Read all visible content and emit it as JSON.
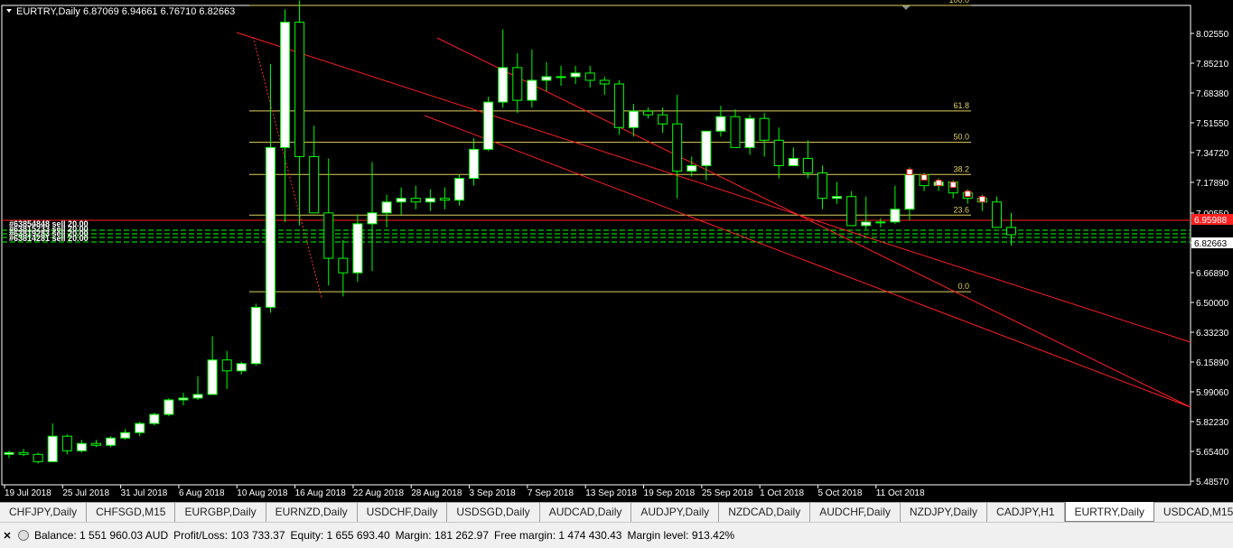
{
  "chart_data": {
    "type": "candlestick",
    "title": "EURTRY,Daily",
    "ohlc_header": "6.87069 6.94661 6.76710 6.82663",
    "ylim": [
      5.4525,
      8.0925
    ],
    "price_ticks": [
      "8.02550",
      "7.85210",
      "7.68380",
      "7.51550",
      "7.34720",
      "7.17890",
      "7.00550",
      "6.83720",
      "6.66890",
      "6.50000",
      "6.33230",
      "6.15890",
      "5.99060",
      "5.82230",
      "5.65400",
      "5.48570"
    ],
    "date_labels": [
      "19 Jul 2018",
      "25 Jul 2018",
      "31 Jul 2018",
      "6 Aug 2018",
      "10 Aug 2018",
      "16 Aug 2018",
      "22 Aug 2018",
      "28 Aug 2018",
      "3 Sep 2018",
      "7 Sep 2018",
      "13 Sep 2018",
      "19 Sep 2018",
      "25 Sep 2018",
      "1 Oct 2018",
      "5 Oct 2018",
      "11 Oct 2018"
    ],
    "date_label_slots": [
      0,
      4,
      8,
      12,
      16,
      20,
      24,
      28,
      32,
      36,
      40,
      44,
      48,
      52,
      56,
      60
    ],
    "current_price": "6.82663",
    "order_price": "6.95988",
    "candles": [
      [
        5.62,
        5.64,
        5.6,
        5.63
      ],
      [
        5.63,
        5.65,
        5.61,
        5.62
      ],
      [
        5.62,
        5.63,
        5.57,
        5.58
      ],
      [
        5.58,
        5.79,
        5.58,
        5.72
      ],
      [
        5.72,
        5.73,
        5.62,
        5.64
      ],
      [
        5.64,
        5.7,
        5.63,
        5.68
      ],
      [
        5.68,
        5.7,
        5.66,
        5.67
      ],
      [
        5.67,
        5.72,
        5.66,
        5.71
      ],
      [
        5.71,
        5.76,
        5.7,
        5.74
      ],
      [
        5.74,
        5.8,
        5.72,
        5.79
      ],
      [
        5.79,
        5.85,
        5.78,
        5.84
      ],
      [
        5.84,
        5.93,
        5.83,
        5.92
      ],
      [
        5.92,
        5.96,
        5.89,
        5.93
      ],
      [
        5.93,
        6.05,
        5.92,
        5.95
      ],
      [
        5.95,
        6.27,
        5.95,
        6.14
      ],
      [
        6.14,
        6.19,
        5.98,
        6.08
      ],
      [
        6.08,
        6.13,
        6.06,
        6.12
      ],
      [
        6.12,
        6.45,
        6.11,
        6.43
      ],
      [
        6.43,
        7.77,
        6.4,
        7.31
      ],
      [
        7.31,
        8.07,
        6.9,
        8.0
      ],
      [
        8.0,
        8.12,
        6.88,
        7.26
      ],
      [
        7.26,
        7.43,
        7.14,
        6.95
      ],
      [
        6.95,
        7.25,
        6.55,
        6.7
      ],
      [
        6.7,
        6.8,
        6.49,
        6.62
      ],
      [
        6.62,
        6.94,
        6.57,
        6.89
      ],
      [
        6.89,
        7.23,
        6.63,
        6.95
      ],
      [
        6.95,
        7.05,
        6.87,
        7.01
      ],
      [
        7.01,
        7.09,
        6.94,
        7.03
      ],
      [
        7.03,
        7.1,
        6.97,
        7.01
      ],
      [
        7.01,
        7.08,
        6.96,
        7.03
      ],
      [
        7.03,
        7.09,
        6.97,
        7.02
      ],
      [
        7.02,
        7.16,
        6.99,
        7.14
      ],
      [
        7.14,
        7.36,
        7.1,
        7.3
      ],
      [
        7.3,
        7.59,
        7.29,
        7.56
      ],
      [
        7.56,
        7.96,
        7.53,
        7.75
      ],
      [
        7.75,
        7.83,
        7.5,
        7.57
      ],
      [
        7.57,
        7.85,
        7.53,
        7.68
      ],
      [
        7.68,
        7.78,
        7.62,
        7.7
      ],
      [
        7.7,
        7.76,
        7.65,
        7.7
      ],
      [
        7.7,
        7.76,
        7.66,
        7.72
      ],
      [
        7.72,
        7.76,
        7.64,
        7.68
      ],
      [
        7.68,
        7.7,
        7.6,
        7.66
      ],
      [
        7.66,
        7.68,
        7.38,
        7.42
      ],
      [
        7.42,
        7.55,
        7.37,
        7.51
      ],
      [
        7.51,
        7.53,
        7.47,
        7.49
      ],
      [
        7.49,
        7.53,
        7.39,
        7.44
      ],
      [
        7.44,
        7.6,
        7.03,
        7.18
      ],
      [
        7.18,
        7.26,
        7.15,
        7.21
      ],
      [
        7.21,
        7.4,
        7.13,
        7.4
      ],
      [
        7.4,
        7.54,
        7.37,
        7.48
      ],
      [
        7.48,
        7.52,
        7.32,
        7.31
      ],
      [
        7.31,
        7.49,
        7.27,
        7.47
      ],
      [
        7.47,
        7.5,
        7.26,
        7.35
      ],
      [
        7.35,
        7.42,
        7.14,
        7.21
      ],
      [
        7.21,
        7.31,
        7.21,
        7.25
      ],
      [
        7.25,
        7.35,
        7.14,
        7.17
      ],
      [
        7.17,
        7.21,
        6.97,
        7.03
      ],
      [
        7.03,
        7.12,
        7.0,
        7.04
      ],
      [
        7.04,
        7.07,
        6.98,
        6.88
      ],
      [
        6.88,
        7.04,
        6.86,
        6.9
      ],
      [
        6.9,
        6.92,
        6.87,
        6.9
      ],
      [
        6.9,
        7.1,
        6.89,
        6.97
      ],
      [
        6.97,
        7.2,
        6.91,
        7.16
      ],
      [
        7.16,
        7.17,
        7.07,
        7.1
      ],
      [
        7.1,
        7.14,
        7.07,
        7.12
      ],
      [
        7.12,
        7.13,
        7.03,
        7.06
      ],
      [
        7.06,
        7.08,
        7.0,
        7.03
      ],
      [
        7.03,
        7.05,
        6.96,
        7.01
      ],
      [
        7.01,
        7.04,
        6.87,
        6.87
      ],
      [
        6.87,
        6.95,
        6.77,
        6.83
      ]
    ],
    "fibonacci": [
      {
        "label": "100.0",
        "price": 8.0925
      },
      {
        "label": "61.8",
        "price": 7.5117
      },
      {
        "label": "50.0",
        "price": 7.3389
      },
      {
        "label": "38.2",
        "price": 7.1614
      },
      {
        "label": "23.6",
        "price": 6.9377
      },
      {
        "label": "0.0",
        "price": 6.5158
      }
    ],
    "order_labels": [
      "#63854848 sell 20.00",
      "#63815233 sell 20.00",
      "#63819283 sell 20.00",
      "#63814281 sell 20.00"
    ]
  },
  "tabs": [
    "CHFJPY,Daily",
    "CHFSGD,M15",
    "EURGBP,Daily",
    "EURNZD,Daily",
    "USDCHF,Daily",
    "USDSGD,Daily",
    "AUDCAD,Daily",
    "AUDJPY,Daily",
    "NZDCAD,Daily",
    "AUDCHF,Daily",
    "NZDJPY,Daily",
    "CADJPY,H1",
    "EURTRY,Daily",
    "USDCAD,M15"
  ],
  "active_tab": "EURTRY,Daily",
  "tab_arrows": {
    "left": "◄",
    "right": "►"
  },
  "status": {
    "balance": "Balance: 1 551 960.03 AUD",
    "profit": "Profit/Loss: 103 733.37",
    "equity": "Equity: 1 655 693.40",
    "margin": "Margin: 181 262.97",
    "free_margin": "Free margin: 1 474 430.43",
    "margin_level": "Margin level: 913.42%"
  },
  "colors": {
    "bull": "#ffffff",
    "bear": "#000000",
    "outline": "#00ff00",
    "fib": "#e0d060",
    "channel": "#ff2020",
    "order": "#00ff00",
    "grid": "#ffffff"
  }
}
